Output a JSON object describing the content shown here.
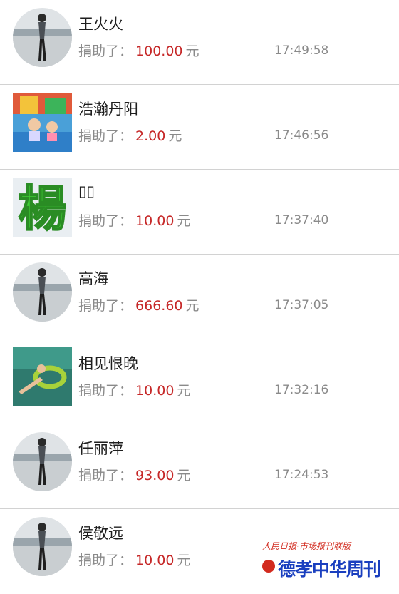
{
  "donations": [
    {
      "name": "王火火",
      "prefix": "捐助了：",
      "amount": "100.00",
      "unit": "元",
      "time": "17:49:58",
      "avatar": "person-on-beach-icon"
    },
    {
      "name": "浩瀚丹阳",
      "prefix": "捐助了：",
      "amount": "2.00",
      "unit": "元",
      "time": "17:46:56",
      "avatar": "kids-inflatable-photo"
    },
    {
      "name": "▯▯",
      "prefix": "捐助了：",
      "amount": "10.00",
      "unit": "元",
      "time": "17:37:40",
      "avatar": "yang-character-image"
    },
    {
      "name": "高海",
      "prefix": "捐助了：",
      "amount": "666.60",
      "unit": "元",
      "time": "17:37:05",
      "avatar": "person-on-beach-icon"
    },
    {
      "name": "相见恨晚",
      "prefix": "捐助了：",
      "amount": "10.00",
      "unit": "元",
      "time": "17:32:16",
      "avatar": "swimmer-photo"
    },
    {
      "name": "任丽萍",
      "prefix": "捐助了：",
      "amount": "93.00",
      "unit": "元",
      "time": "17:24:53",
      "avatar": "person-on-beach-icon"
    },
    {
      "name": "侯敬远",
      "prefix": "捐助了：",
      "amount": "10.00",
      "unit": "元",
      "time": "",
      "avatar": "person-on-beach-icon"
    }
  ],
  "yang_char": "楊",
  "watermark": {
    "top_text": "人民日报·市场报刊联版",
    "main_text": "德孝中华周刊"
  },
  "colors": {
    "amount": "#c62828",
    "muted": "#8a8a8a",
    "divider": "#d2d2d2",
    "watermark_red": "#d22a1e",
    "watermark_blue": "#1a3fbf"
  }
}
